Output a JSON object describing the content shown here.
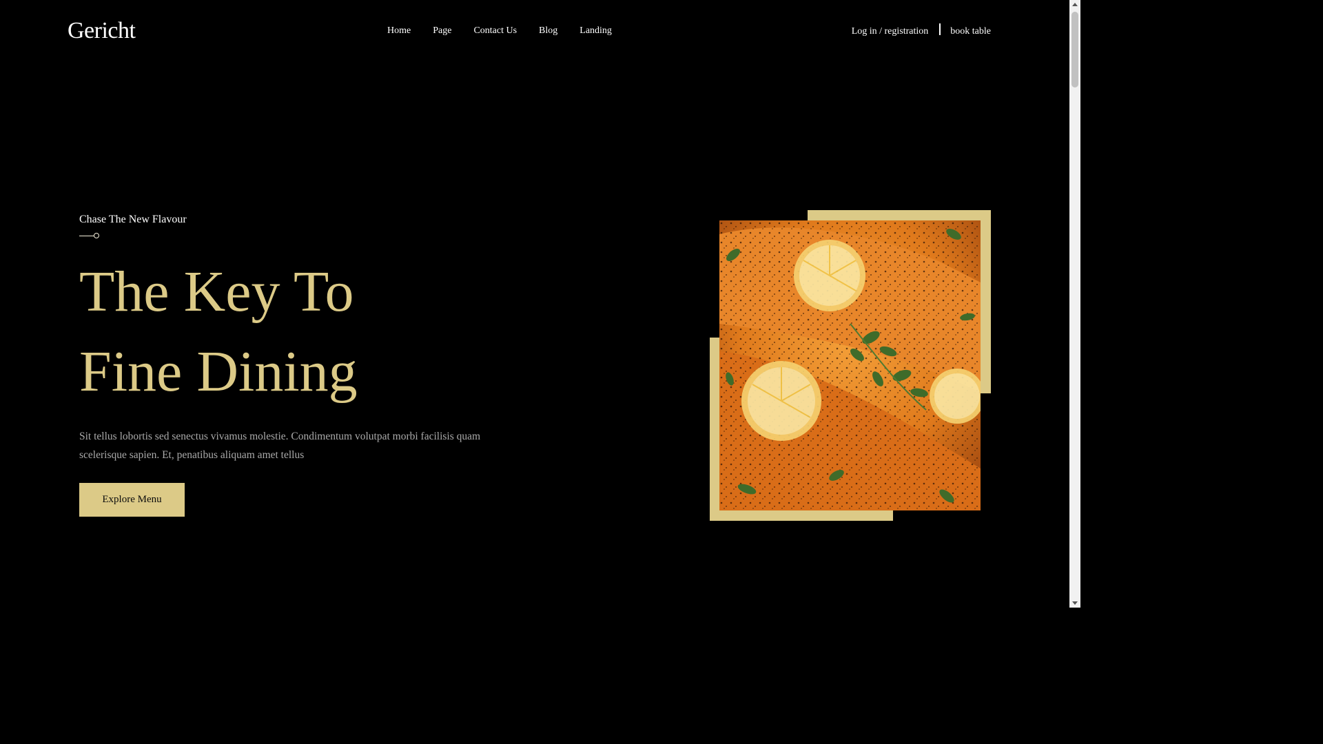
{
  "brand": {
    "logo": "Gericht"
  },
  "nav": {
    "items": [
      {
        "label": "Home"
      },
      {
        "label": "Page"
      },
      {
        "label": "Contact Us"
      },
      {
        "label": "Blog"
      },
      {
        "label": "Landing"
      }
    ],
    "login": "Log in / registration",
    "book": "book table"
  },
  "hero": {
    "subtitle": "Chase The New Flavour",
    "headline_line1": "The Key To",
    "headline_line2": "Fine Dining",
    "description": "Sit tellus lobortis sed senectus vivamus molestie. Condimentum volutpat morbi facilisis quam scelerisque sapien. Et, penatibus aliquam amet tellus",
    "cta": "Explore Menu"
  },
  "colors": {
    "accent": "#dcca87",
    "background": "#000000",
    "text": "#ffffff",
    "muted": "#aaaaaa"
  },
  "image": {
    "subject": "salmon-with-lemon-and-herbs"
  }
}
